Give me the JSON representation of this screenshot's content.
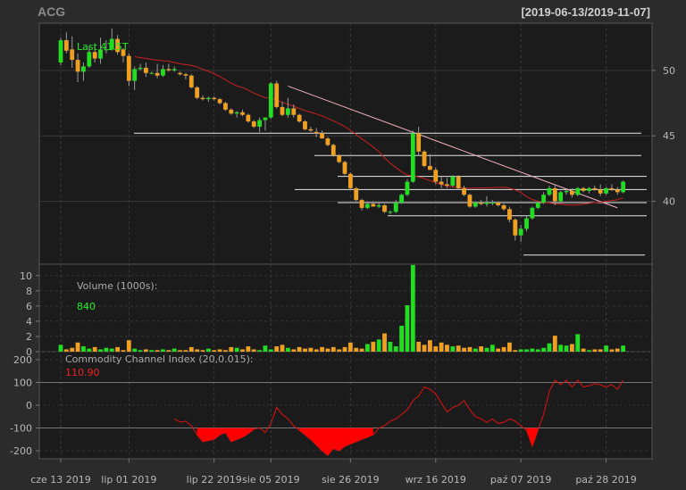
{
  "chart_data": {
    "type": "candlestick",
    "title": "ACG",
    "date_range": "[2019-06-13/2019-11-07]",
    "last_label": "Last 41.5T",
    "price_axis": {
      "ticks": [
        40,
        45,
        50
      ],
      "ylim": [
        35.2,
        53.6
      ]
    },
    "volume": {
      "title": "Volume (1000s):",
      "last": "840",
      "ticks": [
        0,
        2,
        4,
        6,
        8,
        10
      ],
      "ylim": [
        0,
        11.5
      ]
    },
    "cci": {
      "title": "Commodity Channel Index (20,0.015):",
      "last": "110.90",
      "ticks": [
        -200,
        -100,
        0,
        100,
        200
      ],
      "ylim": [
        -235,
        235
      ]
    },
    "x_tick_labels": [
      {
        "label": "cze 13 2019",
        "i": 0
      },
      {
        "label": "lip 01 2019",
        "i": 12
      },
      {
        "label": "lip 22 2019",
        "i": 27
      },
      {
        "label": "sie 05 2019",
        "i": 37
      },
      {
        "label": "sie 26 2019",
        "i": 51
      },
      {
        "label": "wrz 16 2019",
        "i": 66
      },
      {
        "label": "paź 07 2019",
        "i": 81
      },
      {
        "label": "paź 28 2019",
        "i": 96
      }
    ],
    "ohlc": [
      [
        50.6,
        52.5,
        50.4,
        52.3
      ],
      [
        52.3,
        52.9,
        51.3,
        51.5
      ],
      [
        51.6,
        52.6,
        50.2,
        50.8
      ],
      [
        50.8,
        51.3,
        49.1,
        49.9
      ],
      [
        49.9,
        50.6,
        49.2,
        50.3
      ],
      [
        50.3,
        51.8,
        50.2,
        51.4
      ],
      [
        51.4,
        51.9,
        50.6,
        50.9
      ],
      [
        50.9,
        52.5,
        50.5,
        51.6
      ],
      [
        51.6,
        52.3,
        51.3,
        51.6
      ],
      [
        51.6,
        53.2,
        51.5,
        52.4
      ],
      [
        52.4,
        52.7,
        51.2,
        51.4
      ],
      [
        51.6,
        51.7,
        50.6,
        51.1
      ],
      [
        51.1,
        51.3,
        48.8,
        49.2
      ],
      [
        49.2,
        50.3,
        48.5,
        50.1
      ],
      [
        50.1,
        50.5,
        50.0,
        50.2
      ],
      [
        50.2,
        50.6,
        49.5,
        49.8
      ],
      [
        49.8,
        49.9,
        49.7,
        49.8
      ],
      [
        49.8,
        50.5,
        49.4,
        49.6
      ],
      [
        49.6,
        50.4,
        49.5,
        50.1
      ],
      [
        50.1,
        50.5,
        49.9,
        50.0
      ],
      [
        50.0,
        50.3,
        49.9,
        50.1
      ],
      [
        49.8,
        49.9,
        49.6,
        49.7
      ],
      [
        49.7,
        49.8,
        49.3,
        49.6
      ],
      [
        49.6,
        49.7,
        48.6,
        48.7
      ],
      [
        48.7,
        48.8,
        47.8,
        47.9
      ],
      [
        47.9,
        48.1,
        47.7,
        47.8
      ],
      [
        47.8,
        48.0,
        47.6,
        47.9
      ],
      [
        47.9,
        48.0,
        47.7,
        47.8
      ],
      [
        47.8,
        47.9,
        47.4,
        47.5
      ],
      [
        47.5,
        47.6,
        46.9,
        47.0
      ],
      [
        47.0,
        47.1,
        46.6,
        46.7
      ],
      [
        46.7,
        46.9,
        46.4,
        46.8
      ],
      [
        46.8,
        47.0,
        46.5,
        46.6
      ],
      [
        46.6,
        46.7,
        46.0,
        46.1
      ],
      [
        46.1,
        46.2,
        45.6,
        45.7
      ],
      [
        45.7,
        46.4,
        45.3,
        46.2
      ],
      [
        46.2,
        46.3,
        45.4,
        46.4
      ],
      [
        46.4,
        49.1,
        46.3,
        49.0
      ],
      [
        49.0,
        49.2,
        47.1,
        47.2
      ],
      [
        47.2,
        47.6,
        46.5,
        46.6
      ],
      [
        46.6,
        47.9,
        46.4,
        47.1
      ],
      [
        47.1,
        47.4,
        46.4,
        46.6
      ],
      [
        46.6,
        46.7,
        46.0,
        46.1
      ],
      [
        46.1,
        46.2,
        45.4,
        45.5
      ],
      [
        45.5,
        45.7,
        45.3,
        45.4
      ],
      [
        45.3,
        45.6,
        44.9,
        45.2
      ],
      [
        45.2,
        45.4,
        44.8,
        44.8
      ],
      [
        44.8,
        44.9,
        44.2,
        44.3
      ],
      [
        44.3,
        44.4,
        43.4,
        43.5
      ],
      [
        43.5,
        43.6,
        42.9,
        43.0
      ],
      [
        43.0,
        43.1,
        42.0,
        42.1
      ],
      [
        42.1,
        42.2,
        40.9,
        41.0
      ],
      [
        41.0,
        41.1,
        40.0,
        40.1
      ],
      [
        40.1,
        40.2,
        39.3,
        39.5
      ],
      [
        39.5,
        40.0,
        39.4,
        39.8
      ],
      [
        39.8,
        40.0,
        39.6,
        39.6
      ],
      [
        39.6,
        39.9,
        39.5,
        39.7
      ],
      [
        39.7,
        39.8,
        39.1,
        39.2
      ],
      [
        39.2,
        39.3,
        39.0,
        39.2
      ],
      [
        39.2,
        40.1,
        39.1,
        39.9
      ],
      [
        39.9,
        40.6,
        39.8,
        40.5
      ],
      [
        40.5,
        41.7,
        40.4,
        41.5
      ],
      [
        41.5,
        45.4,
        41.4,
        45.2
      ],
      [
        45.2,
        45.7,
        43.5,
        43.8
      ],
      [
        43.8,
        43.9,
        42.6,
        42.7
      ],
      [
        42.7,
        43.6,
        42.4,
        42.4
      ],
      [
        42.4,
        42.6,
        41.3,
        41.5
      ],
      [
        41.5,
        41.9,
        41.0,
        41.3
      ],
      [
        41.3,
        41.8,
        41.0,
        41.2
      ],
      [
        41.2,
        42.0,
        41.1,
        41.9
      ],
      [
        41.9,
        42.0,
        40.9,
        41.0
      ],
      [
        41.0,
        41.2,
        40.4,
        40.5
      ],
      [
        40.5,
        40.6,
        39.5,
        39.6
      ],
      [
        39.6,
        40.0,
        39.5,
        39.9
      ],
      [
        39.9,
        40.1,
        39.7,
        39.8
      ],
      [
        39.8,
        40.4,
        39.6,
        39.9
      ],
      [
        39.9,
        40.1,
        39.7,
        39.9
      ],
      [
        39.9,
        40.0,
        39.6,
        39.7
      ],
      [
        39.7,
        39.8,
        39.3,
        39.4
      ],
      [
        39.4,
        39.6,
        38.4,
        38.6
      ],
      [
        38.6,
        38.7,
        37.0,
        37.4
      ],
      [
        37.4,
        38.2,
        36.9,
        37.9
      ],
      [
        37.9,
        38.9,
        37.7,
        38.7
      ],
      [
        38.7,
        39.6,
        38.6,
        39.5
      ],
      [
        39.5,
        40.0,
        39.4,
        39.9
      ],
      [
        39.9,
        40.7,
        39.8,
        40.5
      ],
      [
        40.5,
        41.2,
        40.4,
        41.0
      ],
      [
        41.0,
        41.3,
        39.7,
        40.0
      ],
      [
        40.0,
        40.8,
        39.9,
        40.7
      ],
      [
        40.7,
        40.9,
        40.5,
        40.8
      ],
      [
        40.8,
        41.0,
        40.3,
        40.5
      ],
      [
        40.5,
        41.1,
        40.4,
        41.0
      ],
      [
        41.0,
        41.1,
        40.7,
        40.8
      ],
      [
        40.8,
        41.1,
        40.6,
        41.0
      ],
      [
        41.0,
        41.2,
        40.8,
        40.9
      ],
      [
        40.9,
        41.3,
        40.4,
        40.6
      ],
      [
        40.6,
        41.1,
        40.5,
        41.0
      ],
      [
        41.0,
        41.3,
        40.8,
        40.9
      ],
      [
        40.9,
        41.1,
        40.5,
        40.7
      ],
      [
        40.7,
        41.6,
        40.6,
        41.5
      ]
    ],
    "volume_values": [
      0.9,
      0.3,
      0.5,
      1.2,
      0.7,
      0.4,
      0.6,
      0.3,
      0.5,
      0.4,
      0.6,
      0.2,
      1.5,
      0.4,
      0.2,
      0.3,
      0.2,
      0.2,
      0.3,
      0.2,
      0.4,
      0.2,
      0.2,
      0.6,
      0.3,
      0.2,
      0.4,
      0.2,
      0.3,
      0.2,
      0.6,
      0.5,
      0.3,
      0.7,
      0.3,
      0.2,
      0.8,
      0.3,
      0.7,
      0.9,
      0.5,
      0.3,
      0.6,
      0.4,
      0.5,
      0.3,
      0.6,
      0.4,
      0.6,
      0.3,
      0.6,
      1.2,
      0.5,
      0.4,
      1.0,
      1.3,
      1.6,
      2.4,
      1.3,
      0.7,
      3.4,
      6.1,
      11.4,
      1.3,
      0.9,
      1.5,
      0.7,
      1.2,
      0.9,
      0.7,
      0.8,
      0.5,
      0.6,
      0.4,
      0.7,
      0.5,
      0.9,
      0.4,
      0.6,
      1.2,
      0.2,
      0.3,
      0.3,
      0.4,
      0.3,
      0.5,
      1.1,
      2.1,
      0.9,
      0.8,
      1.0,
      2.3,
      0.4,
      0.2,
      0.3,
      0.3,
      0.8,
      0.3,
      0.4,
      0.8
    ],
    "cci_values": [
      null,
      null,
      null,
      null,
      null,
      null,
      null,
      null,
      null,
      null,
      null,
      null,
      null,
      null,
      null,
      null,
      null,
      null,
      null,
      null,
      -60,
      -75,
      -70,
      -90,
      -130,
      -160,
      -155,
      -150,
      -130,
      -120,
      -160,
      -150,
      -140,
      -125,
      -105,
      -100,
      -120,
      -80,
      -10,
      -40,
      -60,
      -90,
      -110,
      -130,
      -150,
      -175,
      -200,
      -220,
      -190,
      -200,
      -180,
      -170,
      -160,
      -150,
      -140,
      -130,
      -100,
      -90,
      -70,
      -60,
      -40,
      -20,
      20,
      40,
      80,
      70,
      50,
      10,
      -30,
      -10,
      0,
      20,
      -20,
      -50,
      -60,
      -75,
      -60,
      -80,
      -75,
      -60,
      -70,
      -90,
      -110,
      -180,
      -110,
      -40,
      60,
      110,
      90,
      110,
      80,
      110,
      80,
      85,
      95,
      90,
      80,
      90,
      70,
      110
    ]
  }
}
